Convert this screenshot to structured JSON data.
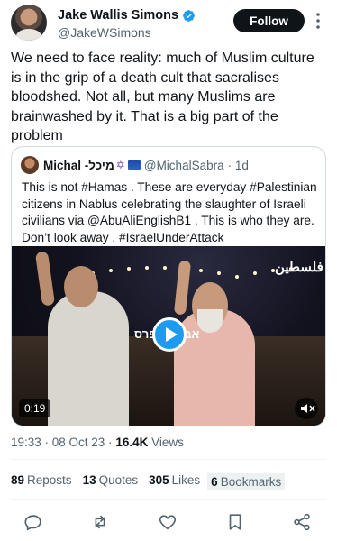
{
  "author": {
    "display_name": "Jake Wallis Simons",
    "handle": "@JakeWSimons",
    "follow_label": "Follow"
  },
  "tweet": {
    "text": "We need to face reality: much of Muslim culture is in the grip of a death cult that sacralises bloodshed. Not all, but many Muslims are brainwashed by it. That is a big part of the problem"
  },
  "quote": {
    "display_name": "Michal -מיכל",
    "handle": "@MichalSabra",
    "age": "· 1d",
    "text": "This is not #Hamas . These are everyday #Palestinian citizens in Nablus celebrating the slaughter of Israeli civilians via @AbuAliEnglishB1 . This is who they are. Don’t look away . #IsraelUnderAttack",
    "video": {
      "logo_text": "فلسطين",
      "overlay_text": "אבו עלי פרס",
      "duration": "0:19"
    }
  },
  "meta": {
    "time": "19:33 · 08 Oct 23 · ",
    "views_count": "16.4K",
    "views_label": " Views"
  },
  "stats": {
    "reposts_count": "89",
    "reposts_label": "Reposts",
    "quotes_count": "13",
    "quotes_label": "Quotes",
    "likes_count": "305",
    "likes_label": "Likes",
    "bookmarks_count": "6",
    "bookmarks_label": "Bookmarks"
  },
  "icons": {
    "more": "more-icon",
    "verified": "verified-badge-icon",
    "reply": "reply-icon",
    "repost": "repost-icon",
    "like": "heart-icon",
    "bookmark": "bookmark-icon",
    "share": "share-icon",
    "mute": "mute-icon",
    "play": "play-icon"
  },
  "colors": {
    "accent": "#1d9bf0",
    "text": "#0f1419",
    "secondary": "#536471"
  }
}
